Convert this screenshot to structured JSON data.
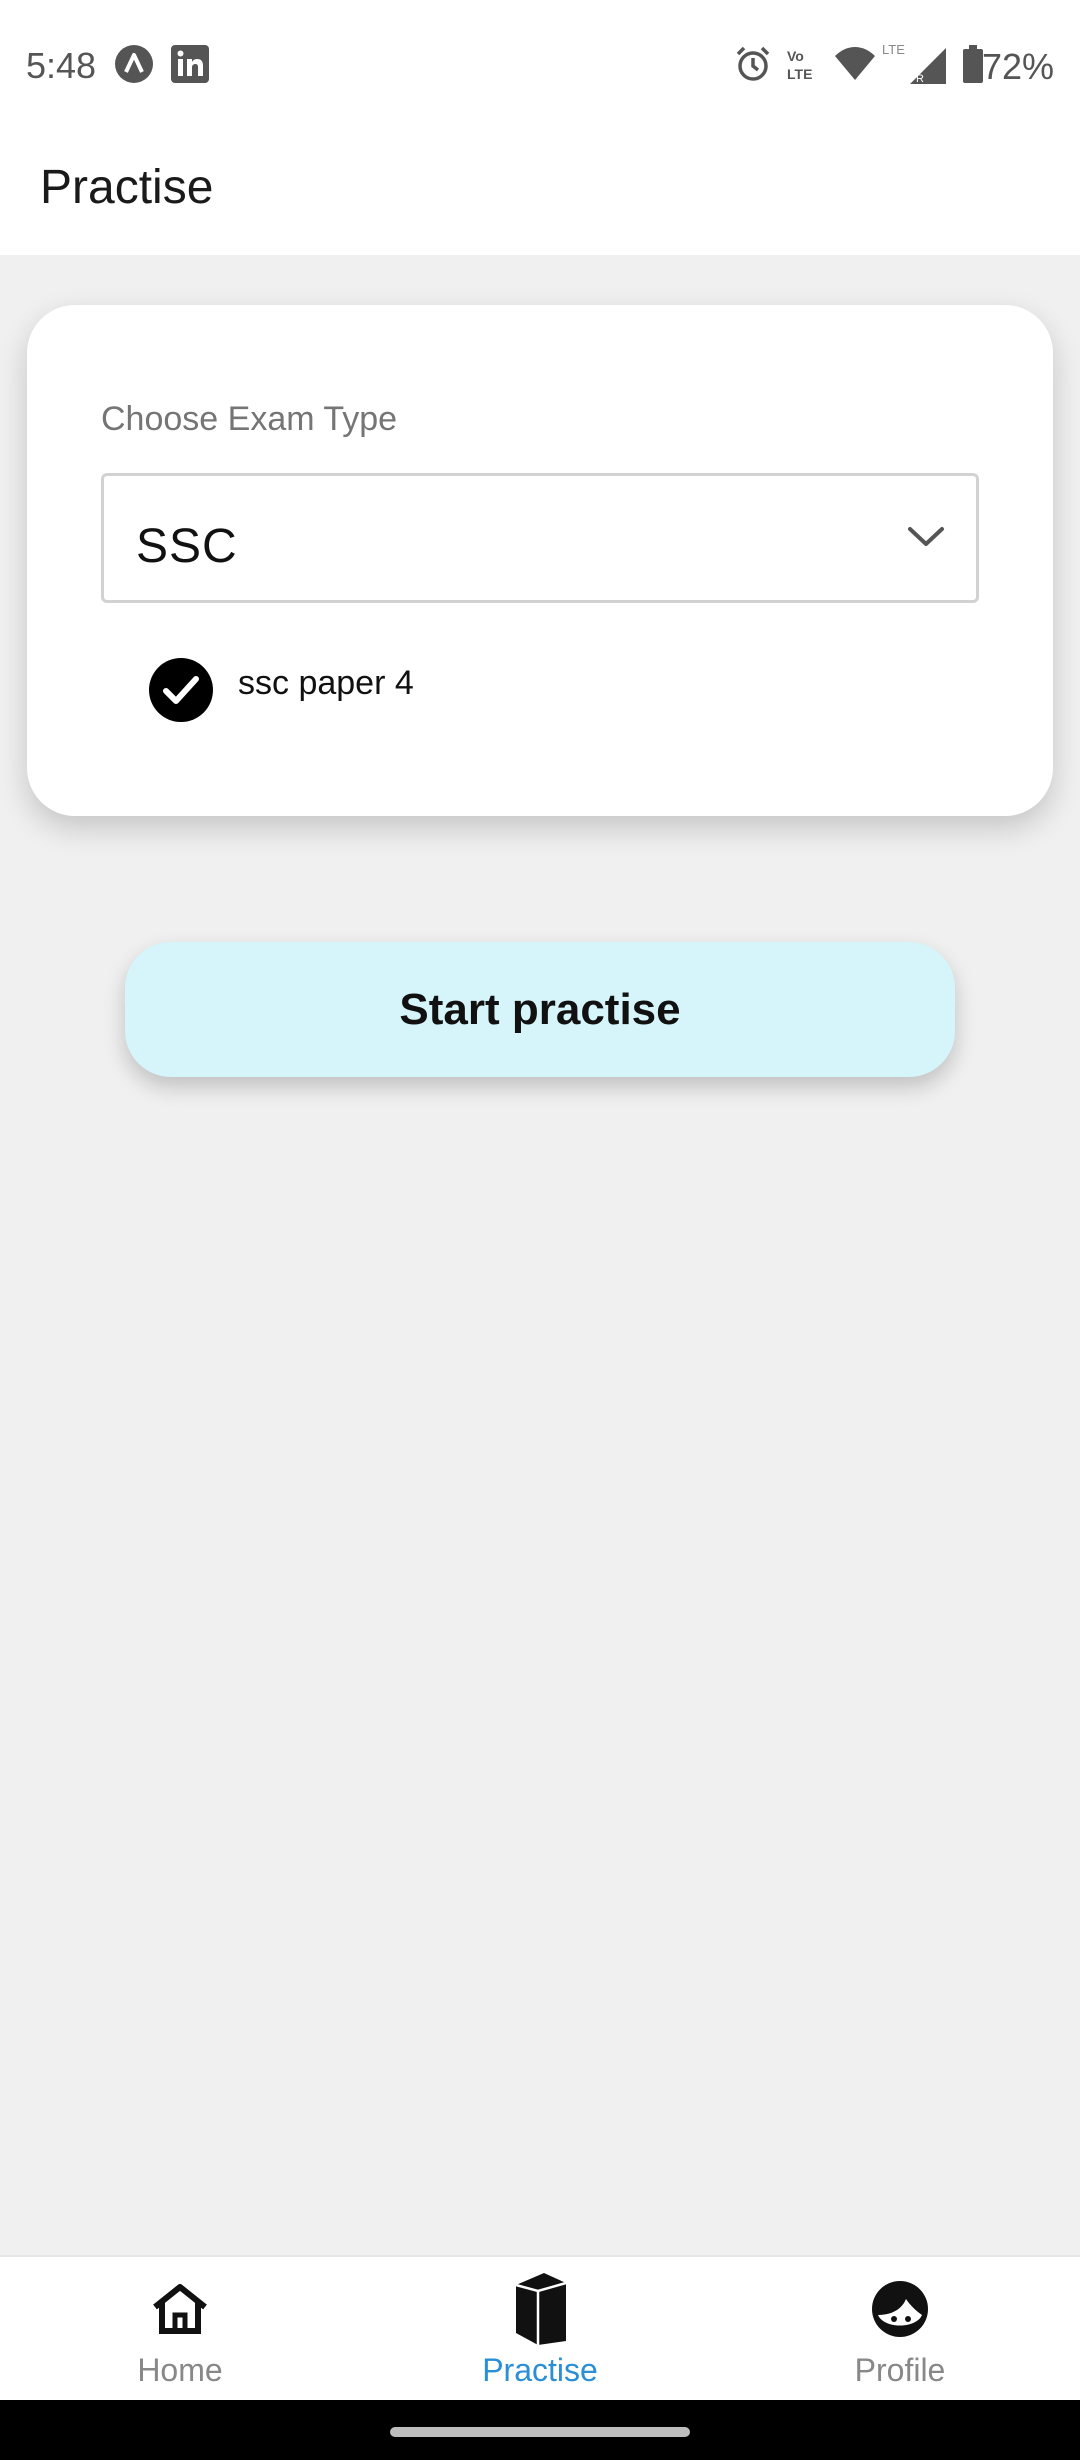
{
  "status_bar": {
    "time": "5:48",
    "battery": "72%",
    "icons_left": [
      "notification-a-icon",
      "linkedin-icon"
    ],
    "icons_right": [
      "alarm-icon",
      "volte-icon",
      "wifi-icon",
      "signal-icon",
      "battery-icon"
    ]
  },
  "app_bar": {
    "title": "Practise"
  },
  "card": {
    "label": "Choose Exam Type",
    "select": {
      "value": "SSC",
      "icon": "chevron-down-icon"
    },
    "checkbox": {
      "label": "ssc paper 4",
      "checked": true
    }
  },
  "start_button": {
    "label": "Start practise",
    "color": "#d6f5fb"
  },
  "bottom_nav": {
    "items": [
      {
        "label": "Home",
        "icon": "home-icon",
        "active": false
      },
      {
        "label": "Practise",
        "icon": "book-icon",
        "active": true
      },
      {
        "label": "Profile",
        "icon": "profile-face-icon",
        "active": false
      }
    ],
    "active_color": "#2a8fd6",
    "inactive_color": "#888888"
  }
}
